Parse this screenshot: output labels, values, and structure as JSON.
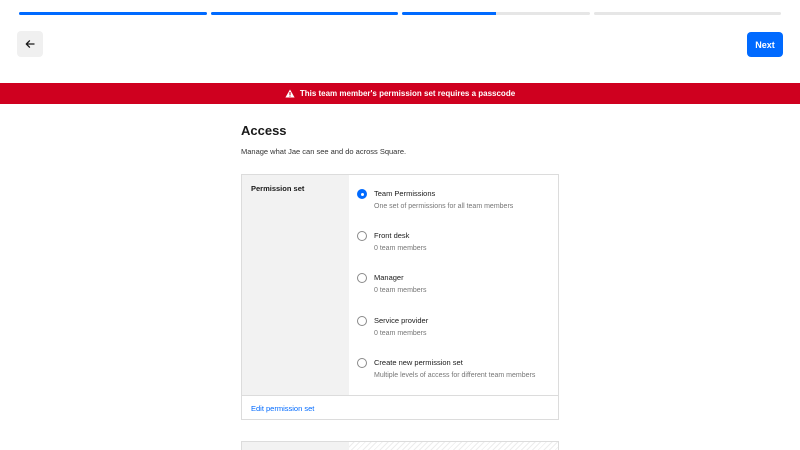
{
  "progress": {
    "segments": [
      {
        "fill": 1.0
      },
      {
        "fill": 1.0
      },
      {
        "fill": 0.5
      },
      {
        "fill": 0.0
      }
    ]
  },
  "header": {
    "back_icon": "arrow-left-icon",
    "next_label": "Next"
  },
  "banner": {
    "icon": "warning-icon",
    "message": "This team member's permission set requires a passcode"
  },
  "page": {
    "title": "Access",
    "subtitle": "Manage what Jae can see and do across Square."
  },
  "permission_card": {
    "label": "Permission set",
    "options": [
      {
        "title": "Team Permissions",
        "description": "One set of permissions for all team members",
        "selected": true
      },
      {
        "title": "Front desk",
        "description": "0 team members",
        "selected": false
      },
      {
        "title": "Manager",
        "description": "0 team members",
        "selected": false
      },
      {
        "title": "Service provider",
        "description": "0 team members",
        "selected": false
      },
      {
        "title": "Create new permission set",
        "description": "Multiple levels of access for different team members",
        "selected": false
      }
    ],
    "edit_link": "Edit permission set"
  },
  "colors": {
    "accent": "#006aff",
    "banner": "#cf001f"
  }
}
